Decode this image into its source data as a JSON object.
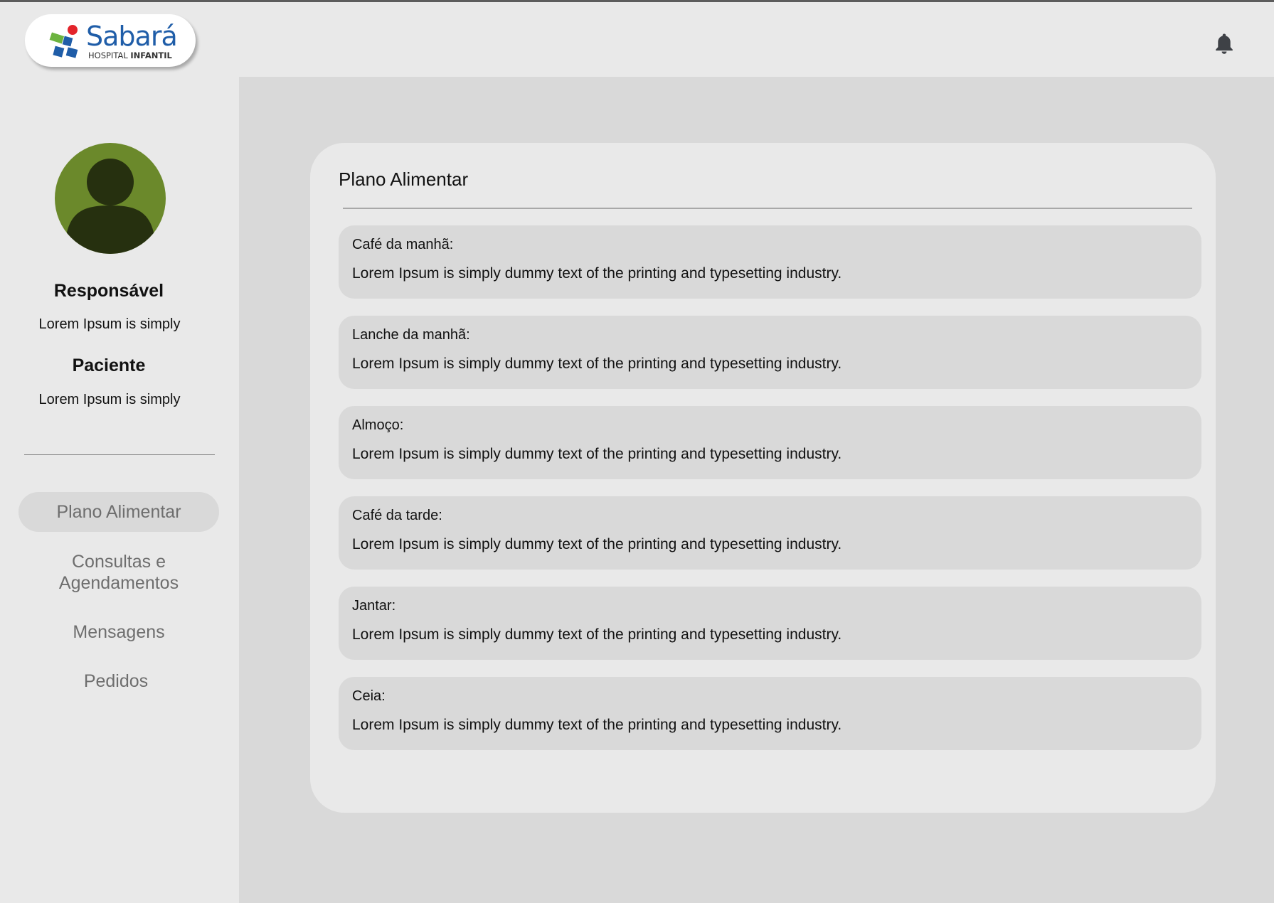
{
  "brand": {
    "name": "Sabará",
    "subtitle_light": "HOSPITAL",
    "subtitle_bold": "INFANTIL",
    "colors": {
      "blue": "#1f5da8",
      "red": "#e3242b",
      "green": "#6cb33f"
    }
  },
  "header": {
    "notification_icon": "bell-icon"
  },
  "sidebar": {
    "responsavel": {
      "heading": "Responsável",
      "value": "Lorem Ipsum is simply"
    },
    "paciente": {
      "heading": "Paciente",
      "value": "Lorem Ipsum is simply"
    },
    "nav": [
      {
        "label": "Plano Alimentar",
        "active": true
      },
      {
        "label": "Consultas e Agendamentos",
        "active": false
      },
      {
        "label": "Mensagens",
        "active": false
      },
      {
        "label": "Pedidos",
        "active": false
      }
    ]
  },
  "main": {
    "title": "Plano Alimentar",
    "meals": [
      {
        "label": "Café da manhã:",
        "text": "Lorem Ipsum is simply dummy text of the printing and typesetting industry."
      },
      {
        "label": "Lanche da manhã:",
        "text": "Lorem Ipsum is simply dummy text of the printing and typesetting industry."
      },
      {
        "label": "Almoço:",
        "text": "Lorem Ipsum is simply dummy text of the printing and typesetting industry."
      },
      {
        "label": "Café da tarde:",
        "text": "Lorem Ipsum is simply dummy text of the printing and typesetting industry."
      },
      {
        "label": "Jantar:",
        "text": "Lorem Ipsum is simply dummy text of the printing and typesetting industry."
      },
      {
        "label": "Ceia:",
        "text": "Lorem Ipsum is simply dummy text of the printing and typesetting industry."
      }
    ]
  }
}
